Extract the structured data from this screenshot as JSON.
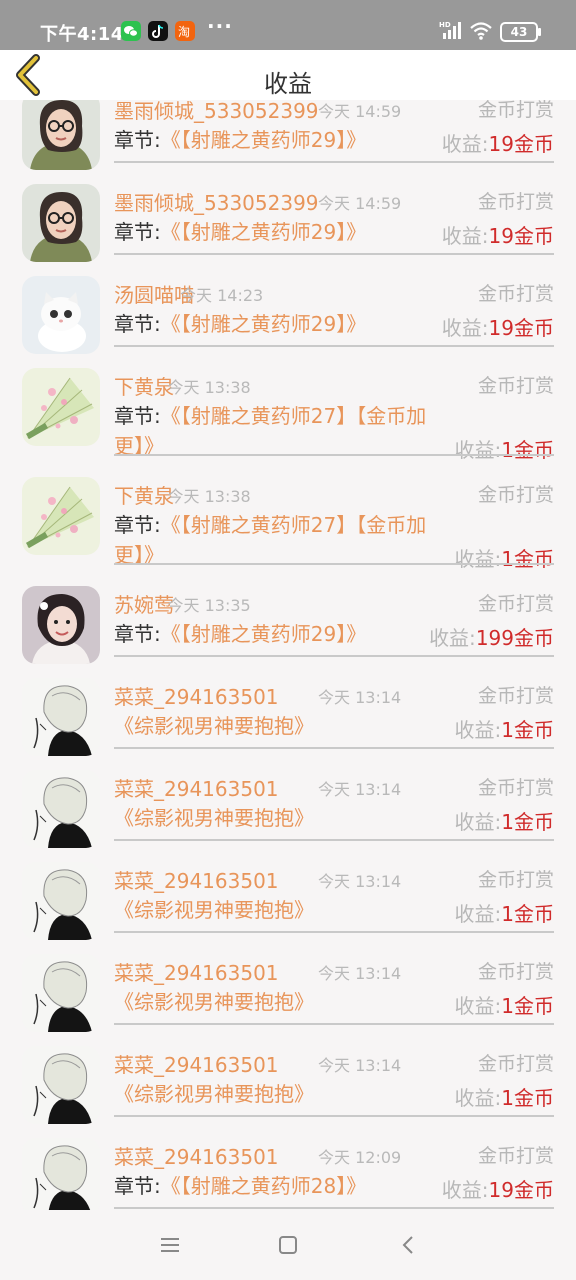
{
  "status_bar": {
    "time": "下午4:14",
    "apps": [
      "wechat-icon",
      "tiktok-icon",
      "taobao-icon"
    ],
    "more": "···",
    "network": "HD",
    "battery": "43"
  },
  "header": {
    "title": "收益",
    "back_icon": "chevron-left-icon"
  },
  "records": [
    {
      "avatar": "woman-glasses",
      "name": "墨雨倾城_533052399",
      "time": "今天 14:59",
      "type": "金币打赏",
      "chapter_prefix": "章节:",
      "chapter": "《【射雕之黄药师29】》",
      "income_label": "收益:",
      "amount": "19金币"
    },
    {
      "avatar": "woman-glasses",
      "name": "墨雨倾城_533052399",
      "time": "今天 14:59",
      "type": "金币打赏",
      "chapter_prefix": "章节:",
      "chapter": "《【射雕之黄药师29】》",
      "income_label": "收益:",
      "amount": "19金币"
    },
    {
      "avatar": "white-kitten",
      "name": "汤圆喵喵",
      "time": "今天 14:23",
      "type": "金币打赏",
      "chapter_prefix": "章节:",
      "chapter": "《【射雕之黄药师29】》",
      "income_label": "收益:",
      "amount": "19金币"
    },
    {
      "avatar": "flower-fan",
      "name": "下黄泉",
      "time": "今天 13:38",
      "type": "金币打赏",
      "chapter_prefix": "章节:",
      "chapter": "《【射雕之黄药师27】【金币加更】》",
      "income_label": "收益:",
      "amount": "1金币"
    },
    {
      "avatar": "flower-fan",
      "name": "下黄泉",
      "time": "今天 13:38",
      "type": "金币打赏",
      "chapter_prefix": "章节:",
      "chapter": "《【射雕之黄药师27】【金币加更】》",
      "income_label": "收益:",
      "amount": "1金币"
    },
    {
      "avatar": "girl-portrait",
      "name": "苏婉莺",
      "time": "今天 13:35",
      "type": "金币打赏",
      "chapter_prefix": "章节:",
      "chapter": "《【射雕之黄药师29】》",
      "income_label": "收益:",
      "amount": "199金币"
    },
    {
      "avatar": "sketch-girl",
      "name": "菜菜_294163501",
      "time": "今天 13:14",
      "type": "金币打赏",
      "chapter_prefix": "",
      "chapter": "《综影视男神要抱抱》",
      "income_label": "收益:",
      "amount": "1金币"
    },
    {
      "avatar": "sketch-girl",
      "name": "菜菜_294163501",
      "time": "今天 13:14",
      "type": "金币打赏",
      "chapter_prefix": "",
      "chapter": "《综影视男神要抱抱》",
      "income_label": "收益:",
      "amount": "1金币"
    },
    {
      "avatar": "sketch-girl",
      "name": "菜菜_294163501",
      "time": "今天 13:14",
      "type": "金币打赏",
      "chapter_prefix": "",
      "chapter": "《综影视男神要抱抱》",
      "income_label": "收益:",
      "amount": "1金币"
    },
    {
      "avatar": "sketch-girl",
      "name": "菜菜_294163501",
      "time": "今天 13:14",
      "type": "金币打赏",
      "chapter_prefix": "",
      "chapter": "《综影视男神要抱抱》",
      "income_label": "收益:",
      "amount": "1金币"
    },
    {
      "avatar": "sketch-girl",
      "name": "菜菜_294163501",
      "time": "今天 13:14",
      "type": "金币打赏",
      "chapter_prefix": "",
      "chapter": "《综影视男神要抱抱》",
      "income_label": "收益:",
      "amount": "1金币"
    },
    {
      "avatar": "sketch-girl",
      "name": "菜菜_294163501",
      "time": "今天 12:09",
      "type": "金币打赏",
      "chapter_prefix": "章节:",
      "chapter": "《【射雕之黄药师28】》",
      "income_label": "收益:",
      "amount": "19金币"
    }
  ],
  "nav_bar": {
    "icons": [
      "menu-icon",
      "home-square-icon",
      "back-arrow-icon"
    ]
  },
  "colors": {
    "accent": "#e8955a",
    "amount": "#d02b2b",
    "back_icon": "#e2c23a"
  }
}
